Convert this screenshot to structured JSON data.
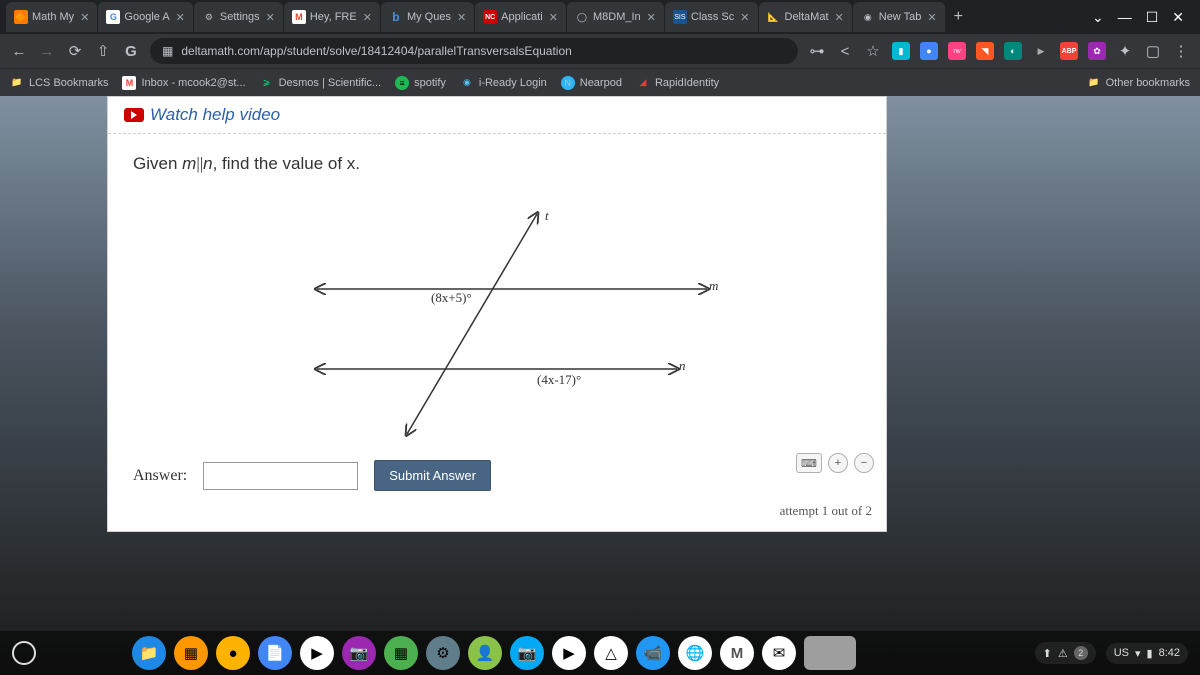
{
  "tabs": [
    {
      "label": "Math My",
      "fav": "🟠"
    },
    {
      "label": "Google A",
      "fav": "G"
    },
    {
      "label": "Settings",
      "fav": "⚙"
    },
    {
      "label": "Hey, FRE",
      "fav": "M"
    },
    {
      "label": "My Ques",
      "fav": "b"
    },
    {
      "label": "Applicati",
      "fav": "NC"
    },
    {
      "label": "M8DM_In",
      "fav": "◯"
    },
    {
      "label": "Class Sc",
      "fav": "SIS"
    },
    {
      "label": "DeltaMat",
      "fav": "📐"
    },
    {
      "label": "New Tab",
      "fav": "◉"
    }
  ],
  "url": "deltamath.com/app/student/solve/18412404/parallelTransversalsEquation",
  "bookmarks": [
    {
      "label": "LCS Bookmarks",
      "ico": "📁"
    },
    {
      "label": "Inbox - mcook2@st...",
      "ico": "M"
    },
    {
      "label": "Desmos | Scientific...",
      "ico": "📈"
    },
    {
      "label": "spotify",
      "ico": "🟢"
    },
    {
      "label": "i-Ready Login",
      "ico": "🔵"
    },
    {
      "label": "Nearpod",
      "ico": "🔵"
    },
    {
      "label": "RapidIdentity",
      "ico": "🔺"
    }
  ],
  "other_bookmarks": "Other bookmarks",
  "help_link": "Watch help video",
  "prompt": {
    "pre": "Given ",
    "mid": ", find the value of x."
  },
  "labels": {
    "m": "m",
    "n": "n",
    "t": "t",
    "upper": "(8x+5)°",
    "lower": "(4x-17)°"
  },
  "answer_label": "Answer:",
  "submit": "Submit Answer",
  "attempt": "attempt 1 out of 2",
  "tray": {
    "lang": "US",
    "time": "8:42",
    "notif": "2",
    "letter": "M"
  }
}
